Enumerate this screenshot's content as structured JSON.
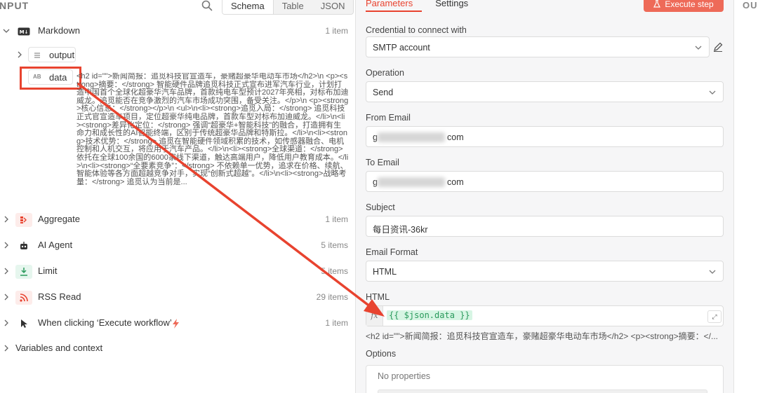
{
  "input_panel": {
    "title": "NPUT",
    "view_tabs": [
      "Schema",
      "Table",
      "JSON"
    ],
    "nodes": [
      {
        "label": "Markdown",
        "count": "1 item",
        "icon": "markdown-icon"
      },
      {
        "label": "Aggregate",
        "count": "1 item",
        "icon": "aggregate-icon"
      },
      {
        "label": "AI Agent",
        "count": "5 items",
        "icon": "robot-icon"
      },
      {
        "label": "Limit",
        "count": "5 items",
        "icon": "limit-icon"
      },
      {
        "label": "RSS Read",
        "count": "29 items",
        "icon": "rss-icon"
      },
      {
        "label": "When clicking ‘Execute workflow’",
        "count": "1 item",
        "icon": "cursor-icon"
      }
    ],
    "markdown_children": {
      "output_label": "output",
      "data_label": "data",
      "data_type": "AB",
      "data_value": "<h2 id=\"\">新闻简报：追觅科技官宣造车，豪赌超豪华电动车市场</h2>\\n <p><strong>摘要：</strong> 智能硬件品牌追觅科技正式宣布进军汽车行业，计划打造中国首个全球化超豪华汽车品牌，首款纯电车型预计2027年亮相，对标布加迪威龙。追觅能否在竞争激烈的汽车市场成功突围，备受关注。</p>\\n <p><strong>核心信息：</strong></p>\\n <ul>\\n<li><strong>追觅入局：</strong> 追觅科技正式官宣造车项目，定位超豪华纯电品牌，首款车型对标布加迪威龙。</li>\\n<li><strong>差异化定位：</strong> 强调“超豪华+智能科技”的融合，打造拥有生命力和成长性的AI智能终端，区别于传统超豪华品牌和特斯拉。</li>\\n<li><strong>技术优势：</strong> 追觅在智能硬件领域积累的技术，如传感器融合、电机控制和人机交互，将应用于汽车产品。</li>\\n<li><strong>全球渠道：</strong> 依托在全球100余国的6000家线下渠道，触达高端用户，降低用户教育成本。</li>\\n<li><strong>“全要素竞争”：</strong> 不依赖单一优势，追求在价格、续航、智能体验等各方面超越竞争对手，实现“创新式超越”。</li>\\n<li><strong>战略考量：</strong> 追觅认为当前是..."
    },
    "variables_label": "Variables and context"
  },
  "params_panel": {
    "tabs": [
      "Parameters",
      "Settings"
    ],
    "execute_label": "Execute step",
    "credential_label": "Credential to connect with",
    "credential_value": "SMTP account",
    "operation_label": "Operation",
    "operation_value": "Send",
    "from_label": "From Email",
    "from_prefix": "g",
    "from_suffix": "com",
    "to_label": "To Email",
    "to_prefix": "g",
    "to_suffix": "com",
    "subject_label": "Subject",
    "subject_value": "每日资讯-36kr",
    "format_label": "Email Format",
    "format_value": "HTML",
    "html_label": "HTML",
    "html_fx": "fx",
    "html_expression": "{{ $json.data }}",
    "html_preview": "<h2 id=\"\">新闻简报：追觅科技官宣造车，豪赌超豪华电动车市场</h2> <p><strong>摘要：</...",
    "options_label": "Options",
    "no_properties": "No properties"
  },
  "output_panel": {
    "title": "OU"
  },
  "colors": {
    "accent": "#e8432f",
    "button": "#ee6a58",
    "expr_bg": "#d7f5e4",
    "expr_text": "#2a9a5c"
  }
}
